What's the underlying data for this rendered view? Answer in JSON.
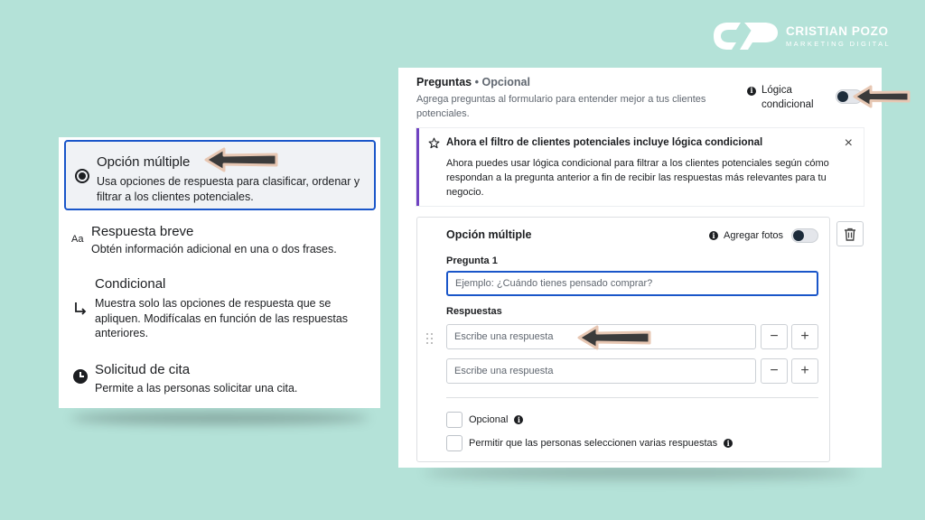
{
  "brand": {
    "name": "CRISTIAN POZO",
    "subtitle": "MARKETING DIGITAL"
  },
  "left_panel": {
    "options": [
      {
        "icon": "radio-selected-icon",
        "title": "Opción múltiple",
        "description": "Usa opciones de respuesta para clasificar, ordenar y filtrar a los clientes potenciales.",
        "selected": true
      },
      {
        "icon": "text-aa-icon",
        "icon_text": "Aa",
        "title": "Respuesta breve",
        "description": "Obtén información adicional en una o dos frases.",
        "selected": false
      },
      {
        "icon": "branch-arrow-icon",
        "title": "Condicional",
        "description": "Muestra solo las opciones de respuesta que se apliquen. Modifícalas en función de las respuestas anteriores.",
        "selected": false
      },
      {
        "icon": "clock-icon",
        "title": "Solicitud de cita",
        "description": "Permite a las personas solicitar una cita.",
        "selected": false
      }
    ]
  },
  "right_panel": {
    "title": "Preguntas",
    "title_suffix": "• Opcional",
    "description": "Agrega preguntas al formulario para entender mejor a tus clientes potenciales.",
    "conditional_logic_label": "Lógica condicional",
    "conditional_logic_enabled": false,
    "notice": {
      "title": "Ahora el filtro de clientes potenciales incluye lógica condicional",
      "body": "Ahora puedes usar lógica condicional para filtrar a los clientes potenciales según cómo respondan a la pregunta anterior a fin de recibir las respuestas más relevantes para tu negocio.",
      "close": "×"
    },
    "card": {
      "title": "Opción múltiple",
      "add_photos_label": "Agregar fotos",
      "add_photos_enabled": false,
      "question_label": "Pregunta 1",
      "question_placeholder": "Ejemplo: ¿Cuándo tienes pensado comprar?",
      "answers_label": "Respuestas",
      "answers": [
        {
          "placeholder": "Escribe una respuesta",
          "minus": "−",
          "plus": "+"
        },
        {
          "placeholder": "Escribe una respuesta",
          "minus": "−",
          "plus": "+"
        }
      ],
      "optional_label": "Opcional",
      "multi_select_label": "Permitir que las personas seleccionen varias respuestas"
    }
  },
  "colors": {
    "background": "#b4e2d8",
    "accent_blue": "#1a56c9",
    "notice_accent": "#6f42c1",
    "arrow": "#3b3b3b",
    "arrow_outline": "#e7c7b3"
  }
}
